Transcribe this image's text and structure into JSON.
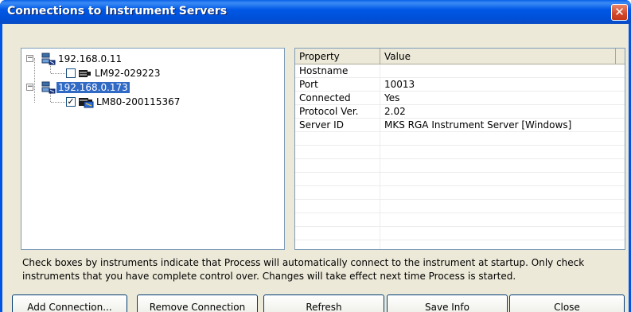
{
  "window": {
    "title": "Connections to Instrument Servers"
  },
  "tree": {
    "servers": [
      {
        "label": "192.168.0.11",
        "selected": false,
        "expanded": true,
        "instrument": {
          "label": "LM92-029223",
          "checked": false
        }
      },
      {
        "label": "192.168.0.173",
        "selected": true,
        "expanded": true,
        "instrument": {
          "label": "LM80-200115367",
          "checked": true
        }
      }
    ]
  },
  "properties": {
    "columns": [
      "Property",
      "Value"
    ],
    "rows": [
      [
        "Hostname",
        ""
      ],
      [
        "Port",
        "10013"
      ],
      [
        "Connected",
        "Yes"
      ],
      [
        "Protocol Ver.",
        "2.02"
      ],
      [
        "Server ID",
        "MKS RGA Instrument Server [Windows]"
      ]
    ]
  },
  "note": "Check boxes by instruments indicate that Process will automatically connect to the instrument at startup. Only check instruments that you have complete control over. Changes will take effect next time Process is started.",
  "buttons": {
    "add": "Add Connection...",
    "remove": "Remove Connection",
    "refresh": "Refresh",
    "save": "Save Info",
    "close": "Close"
  },
  "icons": {
    "server": "server-network-icon",
    "instrument": "instrument-icon",
    "close": "close-icon"
  },
  "colors": {
    "titlebar": "#0054e3",
    "selection": "#316ac5",
    "dialog": "#ece9d8",
    "close": "#d2472a"
  }
}
